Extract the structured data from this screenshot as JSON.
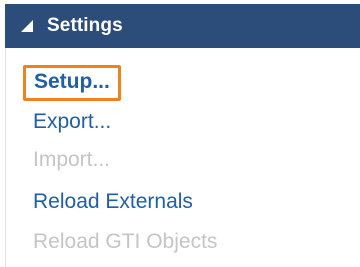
{
  "header": {
    "title": "Settings",
    "caret_icon": "triangle-down-left-icon",
    "background": "#2c4c7a"
  },
  "menu": {
    "items": [
      {
        "label": "Setup...",
        "state": "focused",
        "enabled": true
      },
      {
        "label": "Export...",
        "state": "normal",
        "enabled": true
      },
      {
        "label": "Import...",
        "state": "disabled",
        "enabled": false
      },
      {
        "label": "Reload Externals",
        "state": "normal",
        "enabled": true
      },
      {
        "label": "Reload GTI Objects",
        "state": "disabled",
        "enabled": false
      }
    ]
  },
  "colors": {
    "link": "#1f5fa8",
    "disabled": "#c5c5c5",
    "focus_outline": "#f0821e"
  }
}
